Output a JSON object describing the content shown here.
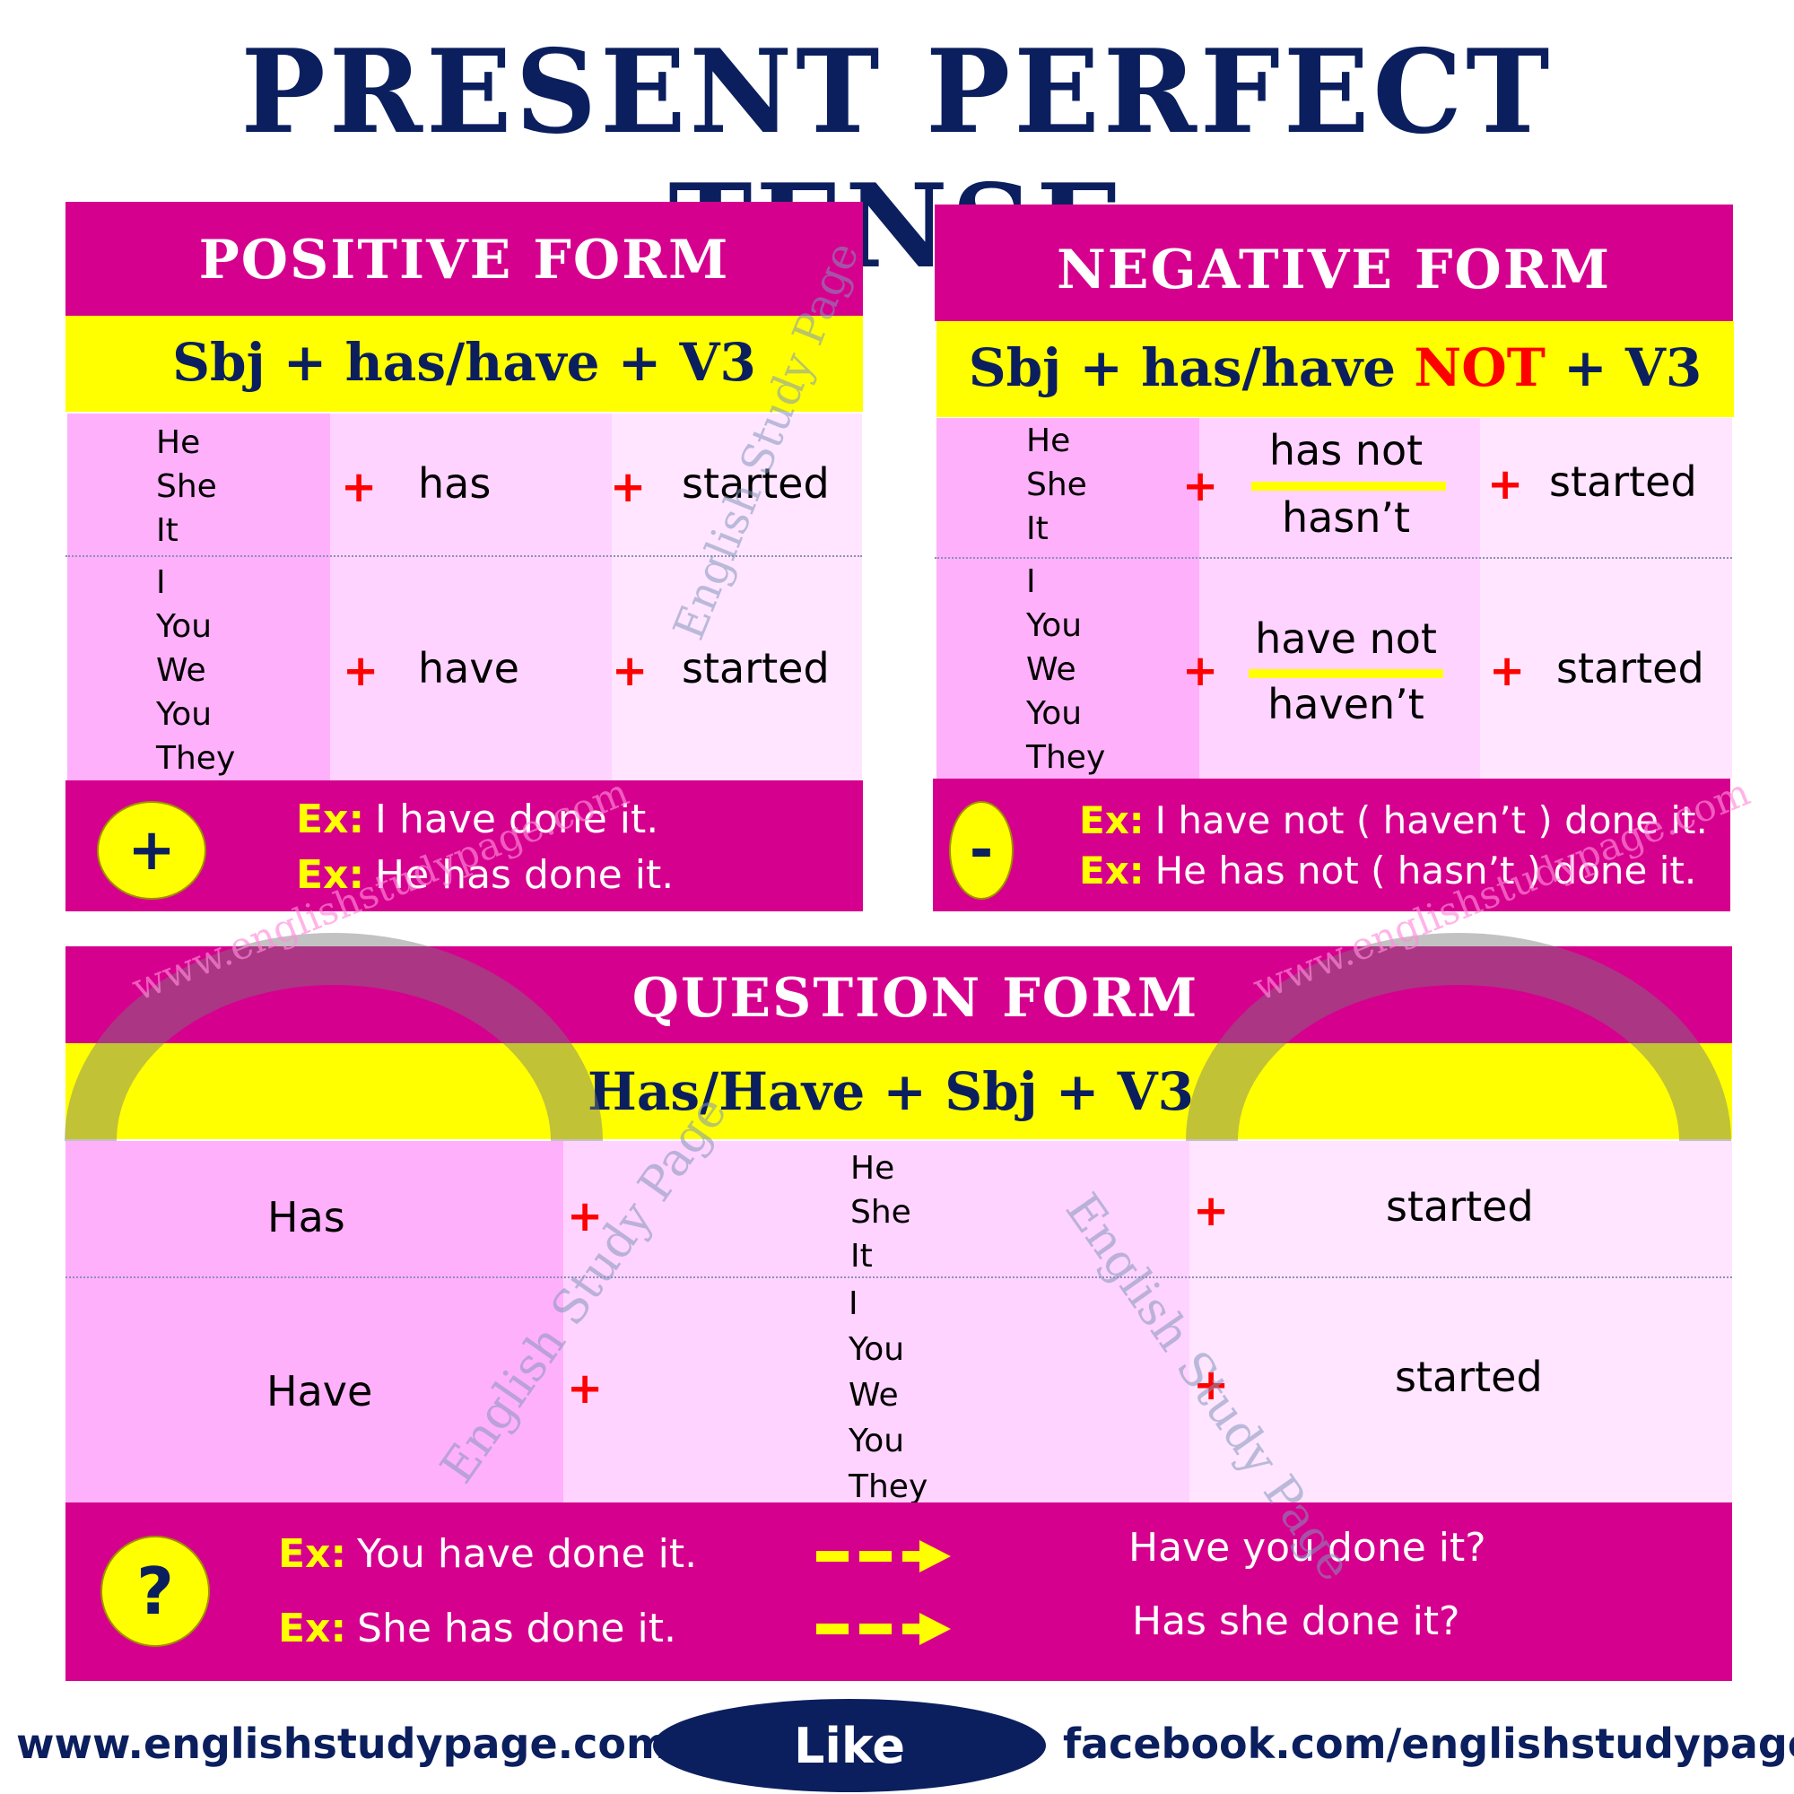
{
  "title": "PRESENT PERFECT TENSE",
  "colors": {
    "navy": "#0B1F5E",
    "magenta": "#D6008E",
    "yellow": "#FFFF00",
    "red": "#FF0000",
    "cell_dark": "#FFB0FB",
    "cell_mid": "#FFD3FF",
    "cell_light": "#FFE5FF"
  },
  "positive": {
    "header": "POSITIVE FORM",
    "formula": "Sbj + has/have + V3",
    "rows": [
      {
        "subjects": [
          "He",
          "She",
          "It"
        ],
        "plus1": "+",
        "aux": "has",
        "plus2": "+",
        "verb": "started"
      },
      {
        "subjects": [
          "I",
          "You",
          "We",
          "You",
          "They"
        ],
        "plus1": "+",
        "aux": "have",
        "plus2": "+",
        "verb": "started"
      }
    ],
    "badge_icon": "+",
    "examples": [
      {
        "label": "Ex:",
        "text": "I have done it."
      },
      {
        "label": "Ex:",
        "text": "He has done it."
      }
    ]
  },
  "negative": {
    "header": "NEGATIVE FORM",
    "formula_pre": "Sbj + has/have ",
    "formula_not": "NOT",
    "formula_post": " + V3",
    "rows": [
      {
        "subjects": [
          "He",
          "She",
          "It"
        ],
        "plus1": "+",
        "aux_full": "has not",
        "aux_short": "hasn’t",
        "plus2": "+",
        "verb": "started"
      },
      {
        "subjects": [
          "I",
          "You",
          "We",
          "You",
          "They"
        ],
        "plus1": "+",
        "aux_full": "have not",
        "aux_short": "haven’t",
        "plus2": "+",
        "verb": "started"
      }
    ],
    "badge_icon": "-",
    "examples": [
      {
        "label": "Ex:",
        "text": "I have not ( haven’t ) done it."
      },
      {
        "label": "Ex:",
        "text": "He has not ( hasn’t ) done it."
      }
    ]
  },
  "question": {
    "header": "QUESTION FORM",
    "formula": "Has/Have +  Sbj + V3",
    "rows": [
      {
        "aux": "Has",
        "plus1": "+",
        "subjects": [
          "He",
          "She",
          "It"
        ],
        "plus2": "+",
        "verb": "started"
      },
      {
        "aux": "Have",
        "plus1": "+",
        "subjects": [
          "I",
          "You",
          "We",
          "You",
          "They"
        ],
        "plus2": "+",
        "verb": "started"
      }
    ],
    "badge_icon": "?",
    "examples": [
      {
        "label": "Ex:",
        "text": "You have done it.",
        "result": "Have you done it?"
      },
      {
        "label": "Ex:",
        "text": "She has done it.",
        "result": "Has she done it?"
      }
    ]
  },
  "watermarks": {
    "brand": "English Study Page",
    "url": "www.englishstudypage.com"
  },
  "footer": {
    "website": "www.englishstudypage.com",
    "like": "Like",
    "facebook": "facebook.com/englishstudypage"
  }
}
